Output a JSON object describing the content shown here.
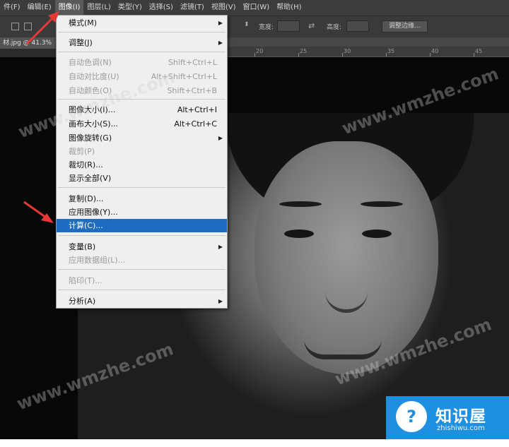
{
  "menubar": {
    "items": [
      "件(F)",
      "编辑(E)",
      "图像(I)",
      "图层(L)",
      "类型(Y)",
      "选择(S)",
      "滤镜(T)",
      "视图(V)",
      "窗口(W)",
      "帮助(H)"
    ]
  },
  "options_bar": {
    "width_label": "宽度:",
    "height_label": "高度:",
    "refine_edge_button": "调整边缘..."
  },
  "document": {
    "tab_label": "材.jpg @ 41.3%",
    "ruler_ticks": [
      "20",
      "25",
      "30",
      "35",
      "40",
      "45"
    ]
  },
  "image_menu": {
    "items": [
      {
        "label": "模式(M)",
        "shortcut": "",
        "submenu": true,
        "disabled": false
      },
      {
        "label": "调整(J)",
        "shortcut": "",
        "submenu": true,
        "disabled": false
      },
      {
        "label": "自动色调(N)",
        "shortcut": "Shift+Ctrl+L",
        "submenu": false,
        "disabled": true
      },
      {
        "label": "自动对比度(U)",
        "shortcut": "Alt+Shift+Ctrl+L",
        "submenu": false,
        "disabled": true
      },
      {
        "label": "自动颜色(O)",
        "shortcut": "Shift+Ctrl+B",
        "submenu": false,
        "disabled": true
      },
      {
        "label": "图像大小(I)...",
        "shortcut": "Alt+Ctrl+I",
        "submenu": false,
        "disabled": false
      },
      {
        "label": "画布大小(S)...",
        "shortcut": "Alt+Ctrl+C",
        "submenu": false,
        "disabled": false
      },
      {
        "label": "图像旋转(G)",
        "shortcut": "",
        "submenu": true,
        "disabled": false
      },
      {
        "label": "裁剪(P)",
        "shortcut": "",
        "submenu": false,
        "disabled": true
      },
      {
        "label": "裁切(R)...",
        "shortcut": "",
        "submenu": false,
        "disabled": false
      },
      {
        "label": "显示全部(V)",
        "shortcut": "",
        "submenu": false,
        "disabled": false
      },
      {
        "label": "复制(D)...",
        "shortcut": "",
        "submenu": false,
        "disabled": false
      },
      {
        "label": "应用图像(Y)...",
        "shortcut": "",
        "submenu": false,
        "disabled": false
      },
      {
        "label": "计算(C)...",
        "shortcut": "",
        "submenu": false,
        "disabled": false,
        "highlighted": true
      },
      {
        "label": "变量(B)",
        "shortcut": "",
        "submenu": true,
        "disabled": false
      },
      {
        "label": "应用数据组(L)...",
        "shortcut": "",
        "submenu": false,
        "disabled": true
      },
      {
        "label": "陷印(T)...",
        "shortcut": "",
        "submenu": false,
        "disabled": true
      },
      {
        "label": "分析(A)",
        "shortcut": "",
        "submenu": true,
        "disabled": false
      }
    ]
  },
  "watermark": "www.wmzhe.com",
  "logo": {
    "title": "知识屋",
    "subtitle": "zhishiwu.com"
  },
  "colors": {
    "highlight": "#1e6dc0",
    "arrow": "#e53935",
    "logo_bg": "#1f8fe0"
  }
}
